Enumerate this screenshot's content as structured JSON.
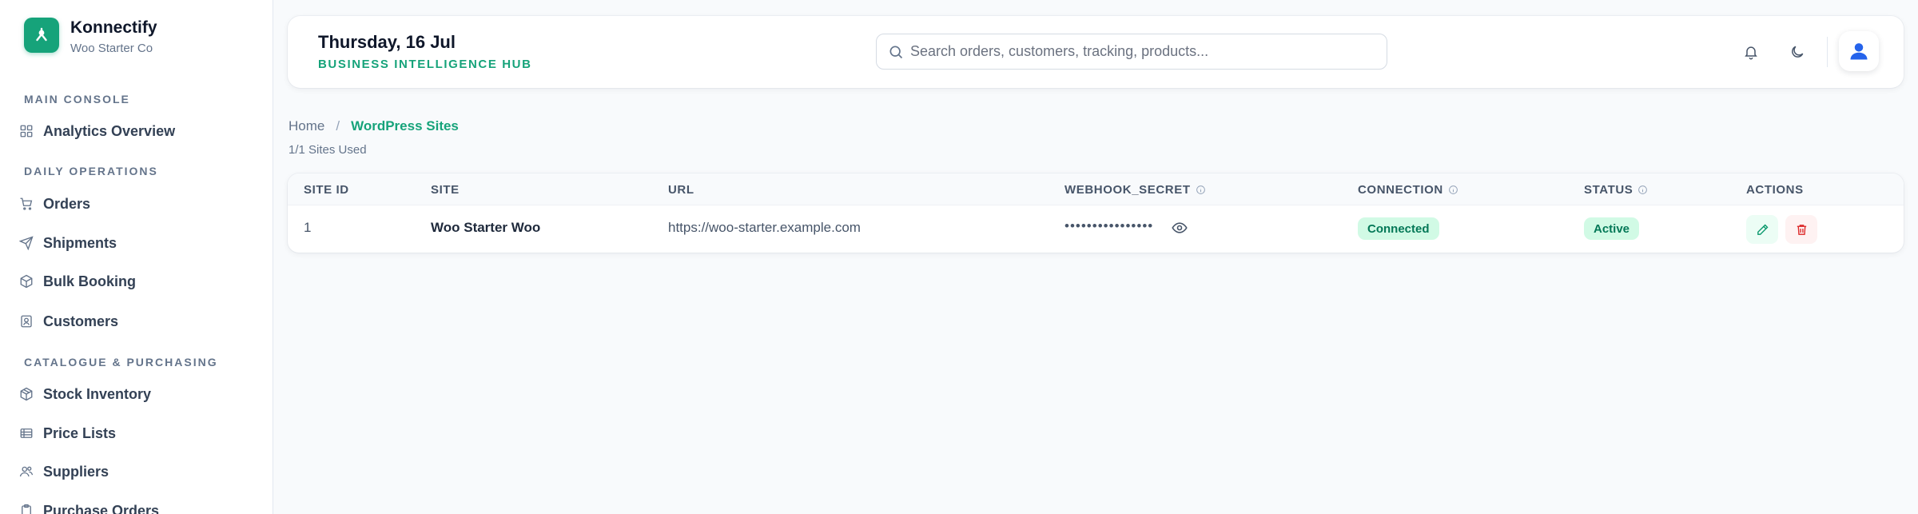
{
  "brand": {
    "name": "Konnectify",
    "subtitle": "Woo Starter Co",
    "color": "#16a37a"
  },
  "sidebar": {
    "sections": [
      {
        "label": "MAIN CONSOLE",
        "items": [
          {
            "label": "Analytics Overview",
            "icon": "grid-icon"
          }
        ]
      },
      {
        "label": "DAILY OPERATIONS",
        "items": [
          {
            "label": "Orders",
            "icon": "cart-icon"
          },
          {
            "label": "Shipments",
            "icon": "send-icon"
          },
          {
            "label": "Bulk Booking",
            "icon": "box-icon"
          },
          {
            "label": "Customers",
            "icon": "contact-icon"
          }
        ]
      },
      {
        "label": "CATALOGUE & PURCHASING",
        "items": [
          {
            "label": "Stock Inventory",
            "icon": "package-icon"
          },
          {
            "label": "Price Lists",
            "icon": "list-icon"
          },
          {
            "label": "Suppliers",
            "icon": "users-icon"
          },
          {
            "label": "Purchase Orders",
            "icon": "clipboard-icon"
          }
        ]
      }
    ]
  },
  "header": {
    "date": "Thursday, 16 Jul",
    "subtitle": "BUSINESS INTELLIGENCE HUB",
    "search_placeholder": "Search orders, customers, tracking, products..."
  },
  "breadcrumb": {
    "home": "Home",
    "separator": "/",
    "current": "WordPress Sites"
  },
  "sites_used": "1/1 Sites Used",
  "table": {
    "columns": {
      "site_id": "SITE ID",
      "site": "SITE",
      "url": "URL",
      "webhook_secret": "WEBHOOK_SECRET",
      "connection": "CONNECTION",
      "status": "STATUS",
      "actions": "ACTIONS"
    },
    "rows": [
      {
        "site_id": "1",
        "site": "Woo Starter Woo",
        "url": "https://woo-starter.example.com",
        "webhook_secret": "••••••••••••••••",
        "connection": "Connected",
        "status": "Active"
      }
    ]
  }
}
